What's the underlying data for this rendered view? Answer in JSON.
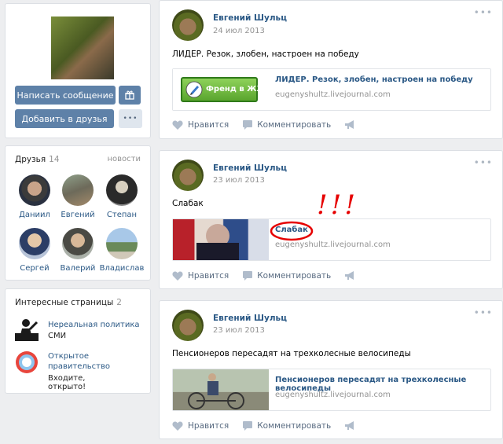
{
  "profile": {
    "message_button": "Написать сообщение",
    "add_friend_button": "Добавить в друзья",
    "gift_icon": "gift-icon",
    "more_button": "•••"
  },
  "friends": {
    "title": "Друзья",
    "count": "14",
    "news_link": "новости",
    "items": [
      {
        "name": "Даниил"
      },
      {
        "name": "Евгений"
      },
      {
        "name": "Степан"
      },
      {
        "name": "Сергей"
      },
      {
        "name": "Валерий"
      },
      {
        "name": "Владислав"
      }
    ]
  },
  "pages": {
    "title": "Интересные страницы",
    "count": "2",
    "items": [
      {
        "name": "Нереальная политика",
        "sub": "СМИ"
      },
      {
        "name": "Открытое правительство",
        "sub": "Входите, открыто!"
      }
    ]
  },
  "posts": [
    {
      "author": "Евгений Шульц",
      "date": "24 июл 2013",
      "text": "ЛИДЕР. Резок, злобен, настроен на победу",
      "link_title": "ЛИДЕР. Резок, злобен, настроен на победу",
      "link_domain": "eugenyshultz.livejournal.com",
      "badge_text": "Френд в ЖЖ!"
    },
    {
      "author": "Евгений Шульц",
      "date": "23 июл 2013",
      "text": "Слабак",
      "link_title": "Слабак",
      "link_domain": "eugenyshultz.livejournal.com",
      "annotation": "!!!"
    },
    {
      "author": "Евгений Шульц",
      "date": "23 июл 2013",
      "text": "Пенсионеров пересадят на трехколесные велосипеды",
      "link_title": "Пенсионеров пересадят на трехколесные велосипеды",
      "link_domain": "eugenyshultz.livejournal.com"
    }
  ],
  "actions": {
    "like": "Нравится",
    "comment": "Комментировать",
    "post_menu": "•••"
  },
  "colors": {
    "accent": "#5e81a8",
    "link": "#2a5885",
    "annotation": "#e60000"
  }
}
